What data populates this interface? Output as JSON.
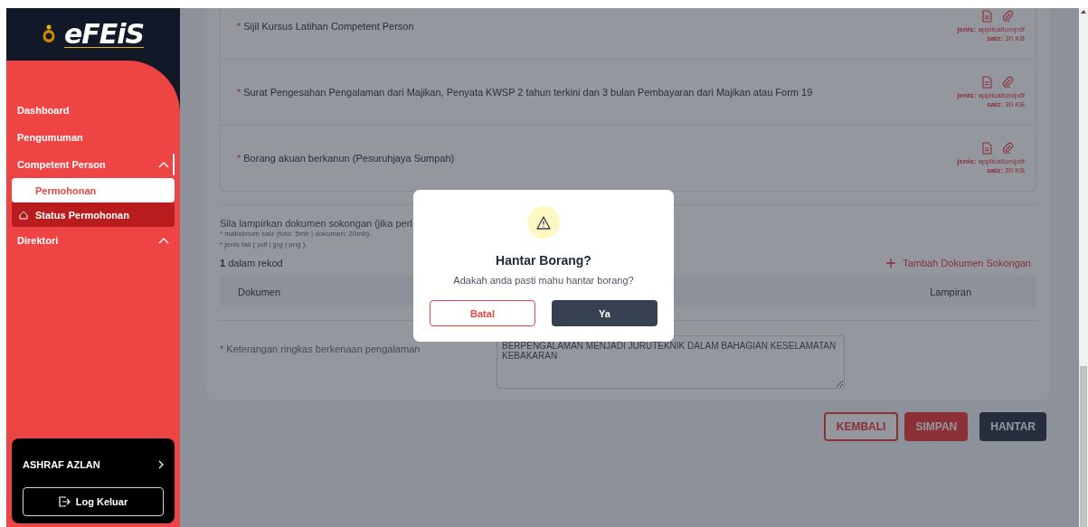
{
  "sidebar": {
    "logo": "eFEiS",
    "items": [
      {
        "label": "Dashboard",
        "expanded": false,
        "active": false
      },
      {
        "label": "Pengumuman",
        "expanded": false,
        "active": false
      },
      {
        "label": "Competent Person",
        "expanded": true,
        "active": true,
        "children": [
          {
            "label": "Permohonan",
            "selected": true,
            "hovered": false
          },
          {
            "label": "Status Permohonan",
            "selected": false,
            "hovered": true
          }
        ]
      },
      {
        "label": "Direktori",
        "expanded": true,
        "active": false
      }
    ],
    "user": {
      "name": "ASHRAF AZLAN"
    },
    "logout": "Log Keluar"
  },
  "documents": [
    {
      "mark": "*",
      "label": "Sijil Kursus Latihan Competent Person",
      "type": "**jenis:** application/pdf",
      "size": "**saiz:** 30 KB"
    },
    {
      "mark": "*",
      "label": "Surat Pengesahan Pengalaman dari Majikan, Penyata KWSP 2 tahun terkini dan 3 bulan Pembayaran dari Majikan atau Form 19",
      "type": "**jenis:** application/pdf",
      "size": "**saiz:** 30 KB"
    },
    {
      "mark": "*",
      "label": "Borang akuan berkanun (Pesuruhjaya Sumpah)",
      "type": "**jenis:** application/pdf",
      "size": "**saiz:** 30 KB"
    }
  ],
  "supporting": {
    "title": "Sila lampirkan dokumen sokongan (jika perl",
    "notes": [
      "* maksimum saiz (foto: 5mb | dokumen: 20mb).",
      "* jenis fail ( pdf | jpg | png )."
    ],
    "count": "**1** dalam rekod",
    "add_button": "Tambah Dokumen Sokongan",
    "columns": [
      "Dokumen",
      "Lampiran"
    ]
  },
  "experience": {
    "label": "* Keterangan ringkas berkenaan pengalaman",
    "value": "BERPENGALAMAN MENJADI JURUTEKNIK DALAM BAHAGIAN KESELAMATAN KEBAKARAN"
  },
  "actions": [
    {
      "label": "KEMBALI",
      "kind": "outline"
    },
    {
      "label": "SIMPAN",
      "kind": "filled"
    },
    {
      "label": "HANTAR",
      "kind": "dark"
    }
  ],
  "dialog": {
    "title": "Hantar Borang?",
    "message": "Adakah anda pasti mahu hantar borang?",
    "buttons": [
      {
        "label": "Batal",
        "kind": "outline"
      },
      {
        "label": "Ya",
        "kind": "dark"
      }
    ]
  }
}
